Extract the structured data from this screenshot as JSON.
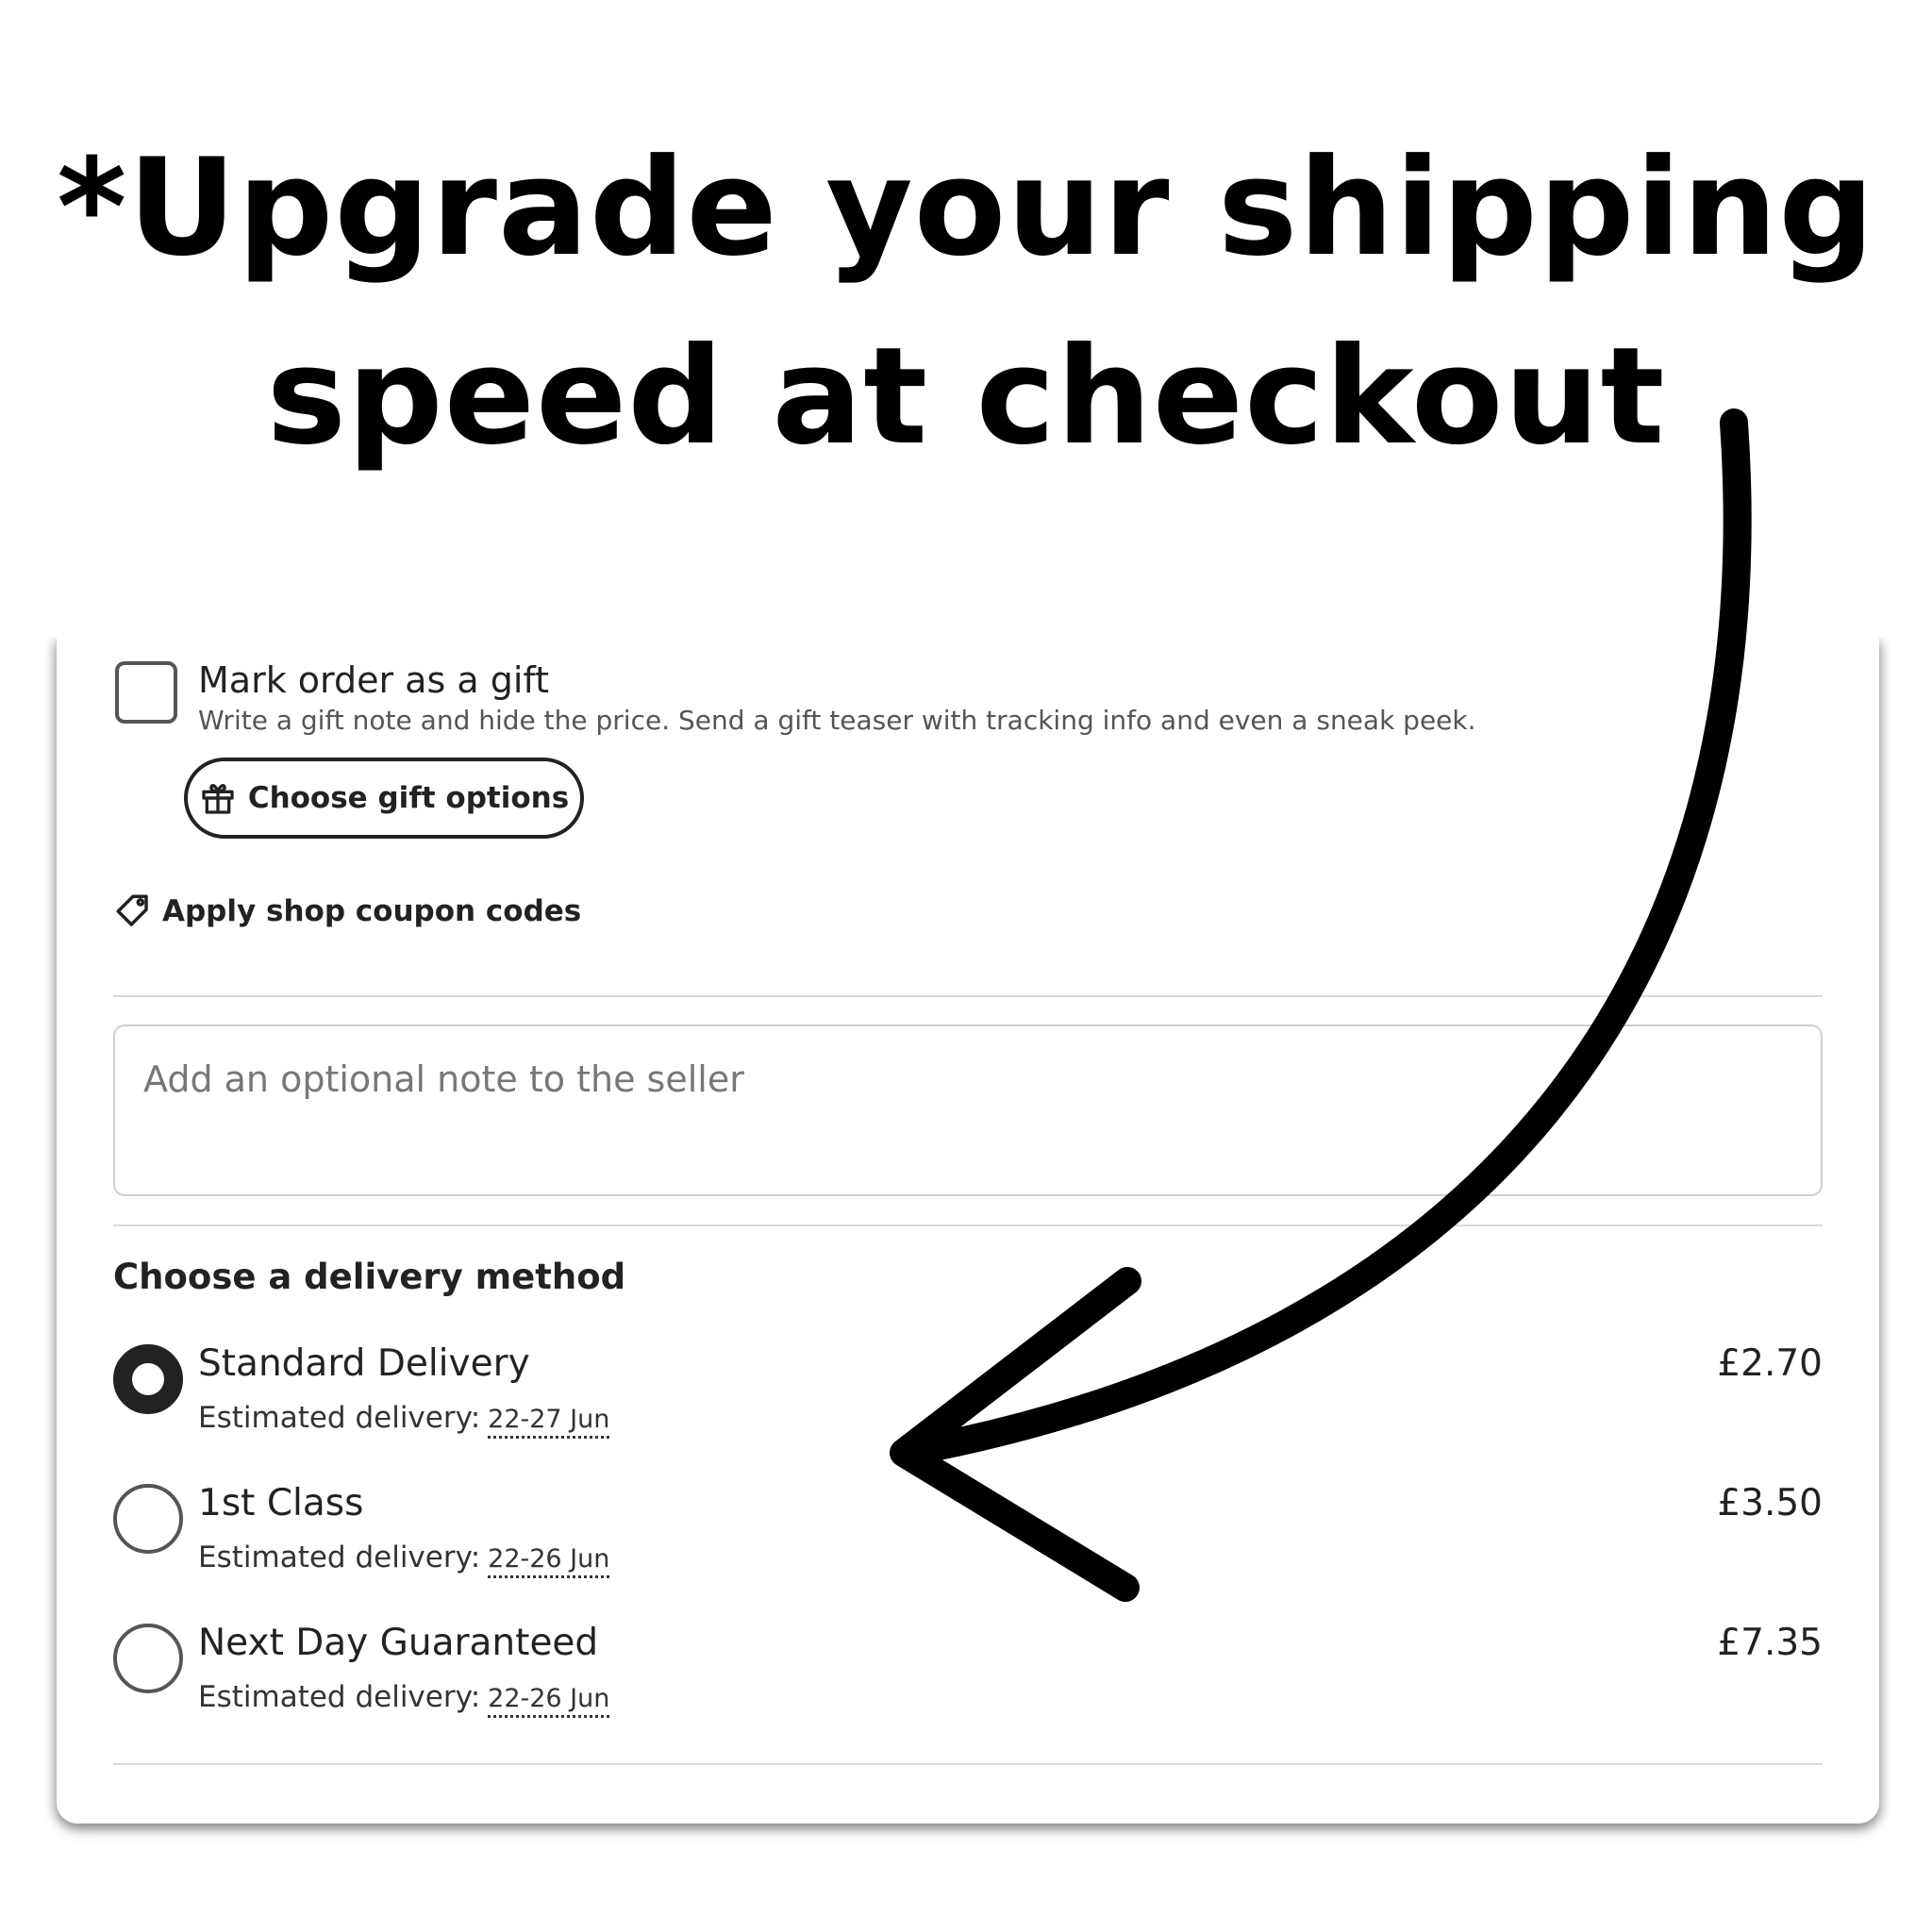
{
  "headline": {
    "line1": "*Upgrade your shipping",
    "line2": "speed at checkout"
  },
  "gift": {
    "checkbox_checked": false,
    "title": "Mark order as a gift",
    "description": "Write a gift note and hide the price. Send a gift teaser with tracking info and even a sneak peek.",
    "button_label": "Choose gift options",
    "button_icon": "gift-icon"
  },
  "coupon": {
    "label": "Apply shop coupon codes",
    "icon": "tag-icon"
  },
  "note": {
    "placeholder": "Add an optional note to the seller"
  },
  "delivery": {
    "heading": "Choose a delivery method",
    "estimated_label": "Estimated delivery:",
    "options": [
      {
        "name": "Standard Delivery",
        "date": "22-27 Jun",
        "price": "£2.70",
        "selected": true
      },
      {
        "name": "1st Class",
        "date": "22-26 Jun",
        "price": "£3.50",
        "selected": false
      },
      {
        "name": "Next Day Guaranteed",
        "date": "22-26 Jun",
        "price": "£7.35",
        "selected": false
      }
    ]
  },
  "annotation": {
    "arrow_color": "#000000"
  }
}
